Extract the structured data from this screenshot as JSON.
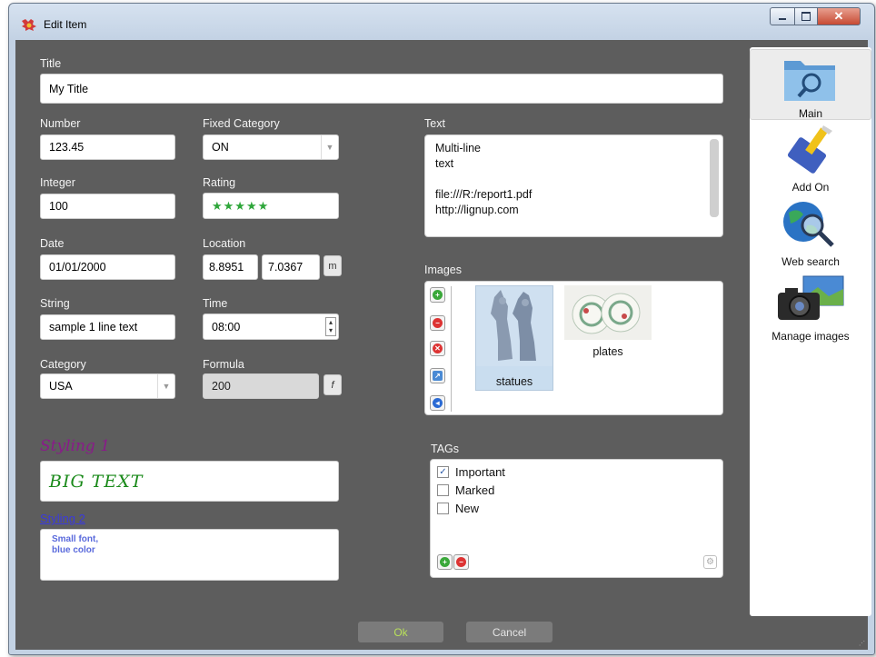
{
  "window": {
    "title": "Edit Item"
  },
  "labels": {
    "title": "Title",
    "number": "Number",
    "fixed_category": "Fixed Category",
    "integer": "Integer",
    "rating": "Rating",
    "date": "Date",
    "location": "Location",
    "string": "String",
    "time": "Time",
    "category": "Category",
    "formula": "Formula",
    "text": "Text",
    "images": "Images",
    "tags": "TAGs"
  },
  "fields": {
    "title": "My Title",
    "number": "123.45",
    "fixed_category": "ON",
    "integer": "100",
    "rating_value": 5,
    "rating_max": 5,
    "rating_text": "★★★★★",
    "date": "01/01/2000",
    "location_lat": "8.8951",
    "location_lon": "7.0367",
    "location_button": "m",
    "string": "sample 1 line text",
    "time": "08:00",
    "category": "USA",
    "formula": "200",
    "formula_button": "f"
  },
  "text_lines": [
    "Multi-line",
    "text",
    "",
    "file:///R:/report1.pdf",
    "http://lignup.com"
  ],
  "images": [
    {
      "caption": "statues",
      "selected": true
    },
    {
      "caption": "plates",
      "selected": false
    }
  ],
  "tags": [
    {
      "label": "Important",
      "checked": true
    },
    {
      "label": "Marked",
      "checked": false
    },
    {
      "label": "New",
      "checked": false
    }
  ],
  "styling": {
    "label1": "Styling 1",
    "big_text": "BIG TEXT",
    "label2": "Styling 2",
    "small_line1": "Small font,",
    "small_line2": "blue color"
  },
  "nav": [
    {
      "label": "Main",
      "icon": "folder-search-icon",
      "selected": true
    },
    {
      "label": "Add On",
      "icon": "brush-icon",
      "selected": false
    },
    {
      "label": "Web search",
      "icon": "globe-search-icon",
      "selected": false
    },
    {
      "label": "Manage images",
      "icon": "camera-icon",
      "selected": false
    }
  ],
  "buttons": {
    "ok": "Ok",
    "cancel": "Cancel"
  },
  "colors": {
    "background": "#5d5d5d",
    "label": "#f4f4f4",
    "styling1": "#8a1a8a",
    "big_text": "#1a8a1a",
    "small_text": "#5a6adc",
    "ok_text": "#b8e05a",
    "star": "#2ea63a"
  }
}
